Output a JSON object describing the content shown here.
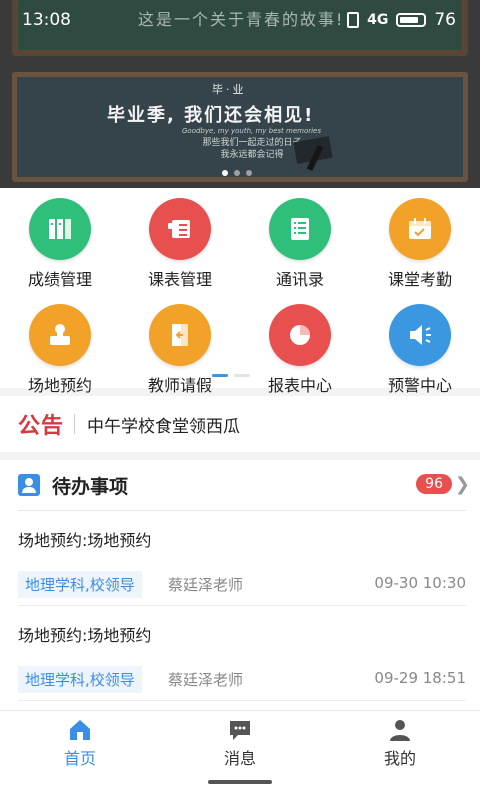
{
  "status_bar": {
    "time": "13:08",
    "signal": "4G",
    "battery": "76"
  },
  "banner": {
    "top_board_text": "这是一个关于青春的故事!",
    "sub": "毕·业",
    "title": "毕业季, 我们还会相见!",
    "english": "Goodbye, my youth, my best memories",
    "line1": "那些我们一起走过的日子",
    "line2": "我永远都会记得"
  },
  "grid": [
    {
      "label": "成绩管理",
      "icon": "grades-icon",
      "color": "#2fbf7a"
    },
    {
      "label": "课表管理",
      "icon": "schedule-icon",
      "color": "#e8504f"
    },
    {
      "label": "通讯录",
      "icon": "contacts-icon",
      "color": "#2fbf7a"
    },
    {
      "label": "课堂考勤",
      "icon": "attendance-icon",
      "color": "#f3a229"
    },
    {
      "label": "场地预约",
      "icon": "venue-icon",
      "color": "#f3a229"
    },
    {
      "label": "教师请假",
      "icon": "leave-icon",
      "color": "#f3a229"
    },
    {
      "label": "报表中心",
      "icon": "report-icon",
      "color": "#e8504f"
    },
    {
      "label": "预警中心",
      "icon": "alarm-icon",
      "color": "#3b97e0"
    }
  ],
  "notice": {
    "logo": "公告",
    "text": "中午学校食堂领西瓜"
  },
  "todo": {
    "title": "待办事项",
    "count": "96",
    "items": [
      {
        "title": "场地预约:场地预约",
        "tag": "地理学科,校领导",
        "teacher": "蔡廷泽老师",
        "time": "09-30 10:30"
      },
      {
        "title": "场地预约:场地预约",
        "tag": "地理学科,校领导",
        "teacher": "蔡廷泽老师",
        "time": "09-29 18:51"
      }
    ]
  },
  "nav": [
    {
      "label": "首页",
      "icon": "home-icon",
      "active": true
    },
    {
      "label": "消息",
      "icon": "message-icon",
      "active": false
    },
    {
      "label": "我的",
      "icon": "profile-icon",
      "active": false
    }
  ],
  "colors": {
    "accent": "#3b8ee6",
    "badge": "#e8504f",
    "notice": "#d9363e"
  }
}
